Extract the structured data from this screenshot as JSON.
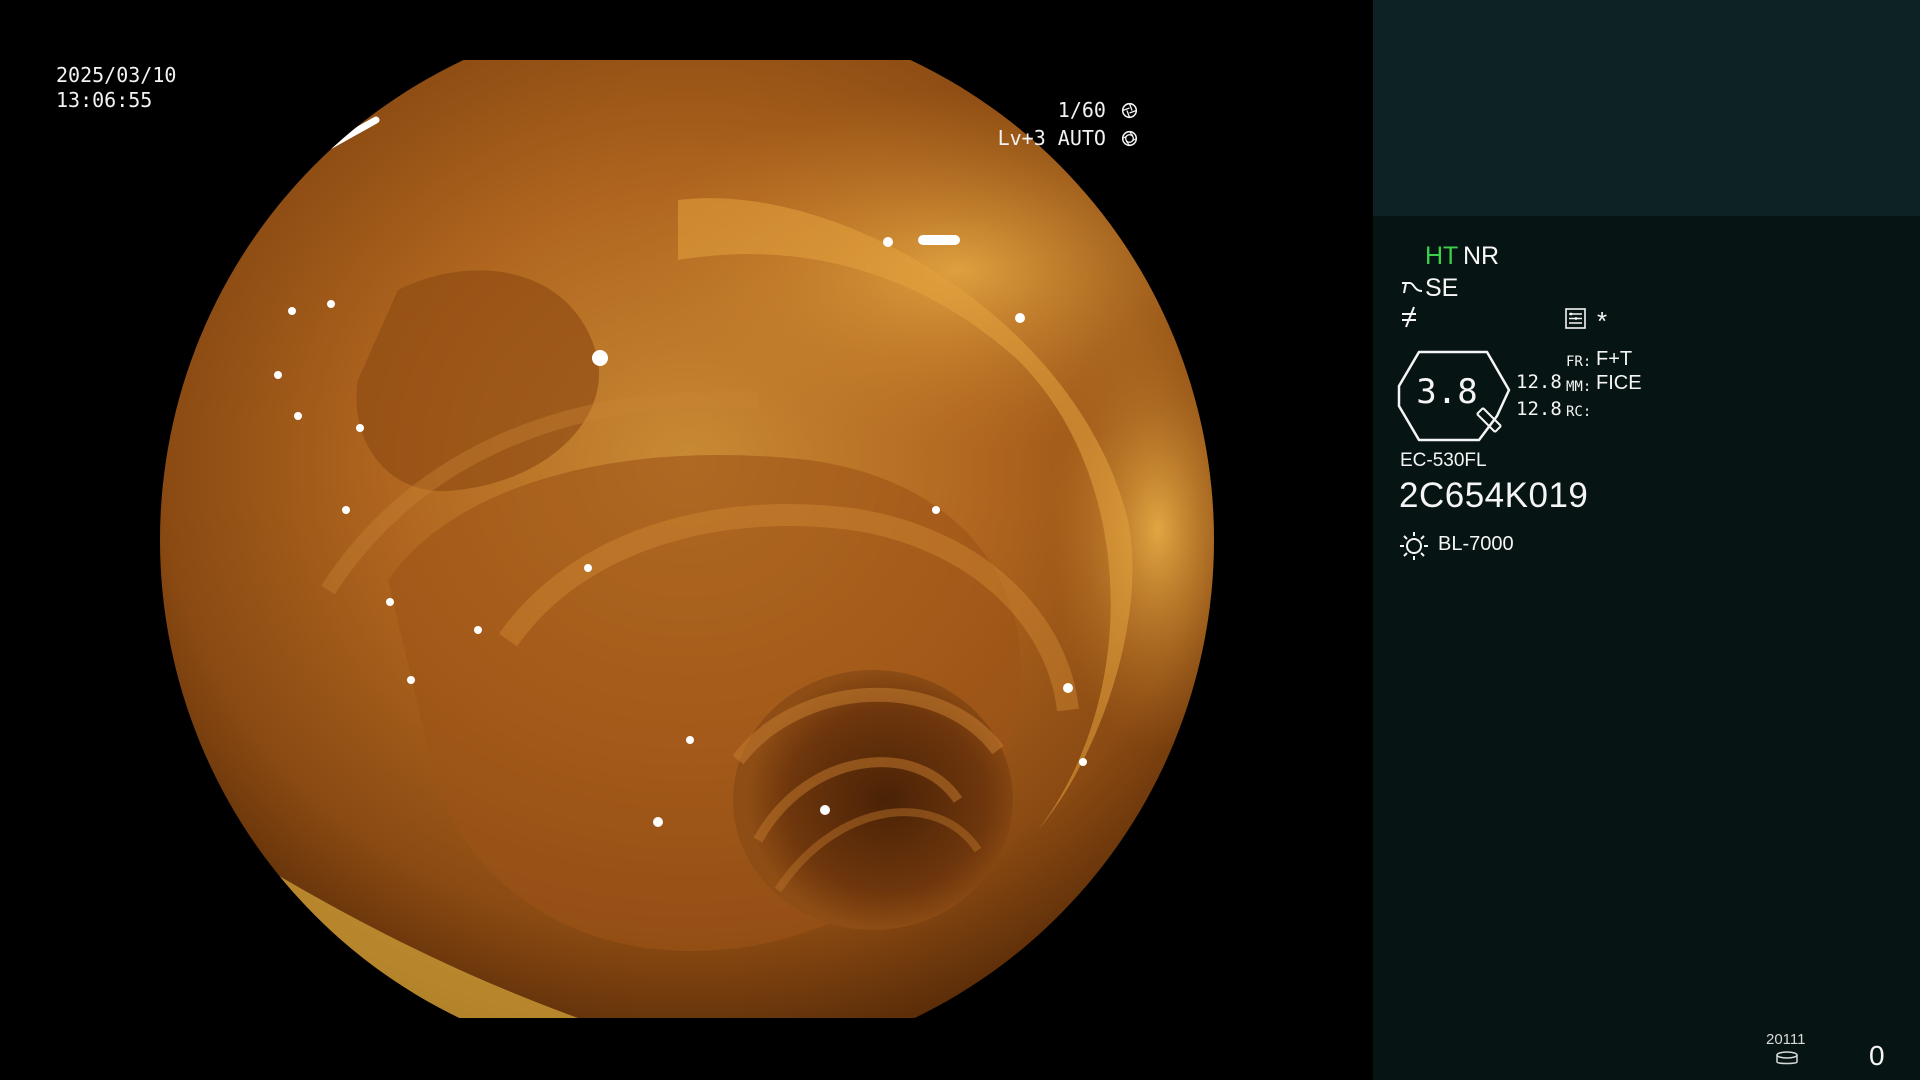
{
  "overlay": {
    "date": "2025/03/10",
    "time": "13:06:55",
    "shutter": "1/60",
    "shutter_icon": "shutter-icon",
    "level": "Lv+3 AUTO",
    "level_icon": "iris-icon"
  },
  "panel": {
    "ht": "HT",
    "nr": "NR",
    "se": "SE",
    "asterisk": "*",
    "gauge_value": "3.8",
    "value_1": "12.8",
    "value_2": "12.8",
    "fr_label": "FR:",
    "fr_value": "F+T",
    "mm_label": "MM:",
    "mm_value": "FICE",
    "rc_label": "RC:",
    "scope_model": "EC-530FL",
    "serial_number": "2C654K019",
    "light_source": "BL-7000",
    "bottom_code": "20111",
    "counter": "0",
    "colors": {
      "panel_background": "#071414",
      "panel_top_background": "#0c2224",
      "ht_green": "#3bd24a"
    }
  }
}
